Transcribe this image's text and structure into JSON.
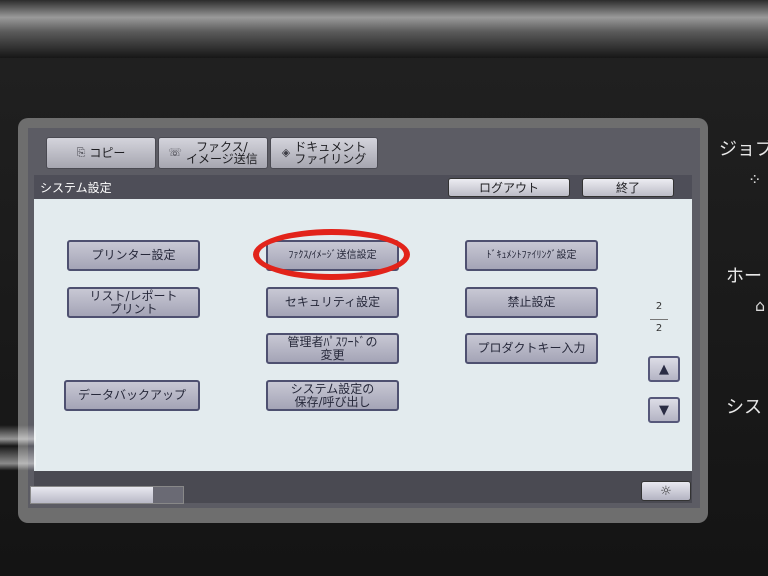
{
  "tabs": [
    {
      "label": "コピー",
      "icon": "copy-icon"
    },
    {
      "label": "ファクス/\nイメージ送信",
      "icon": "fax-icon"
    },
    {
      "label": "ドキュメント\nファイリング",
      "icon": "document-filing-icon"
    }
  ],
  "header": {
    "title": "システム設定",
    "logout_label": "ログアウト",
    "exit_label": "終了"
  },
  "settings": {
    "printer": "プリンター設定",
    "fax_image_send": "ﾌｧｸｽ/ｲﾒｰｼﾞ送信設定",
    "document_filing": "ﾄﾞｷｭﾒﾝﾄﾌｧｲﾘﾝｸﾞ設定",
    "list_report_print": "リスト/レポート\nプリント",
    "security": "セキュリティ設定",
    "prohibit": "禁止設定",
    "admin_password": "管理者ﾊﾟｽﾜｰﾄﾞの\n変更",
    "product_key": "プロダクトキー入力",
    "data_backup": "データバックアップ",
    "system_save_recall": "システム設定の\n保存/呼び出し"
  },
  "pagination": {
    "current": "2",
    "total": "2"
  },
  "highlight": {
    "target": "fax_image_send",
    "color": "#e2231a"
  },
  "side_keys": {
    "job": "ジョブ",
    "home": "ホー",
    "system": "シス"
  }
}
